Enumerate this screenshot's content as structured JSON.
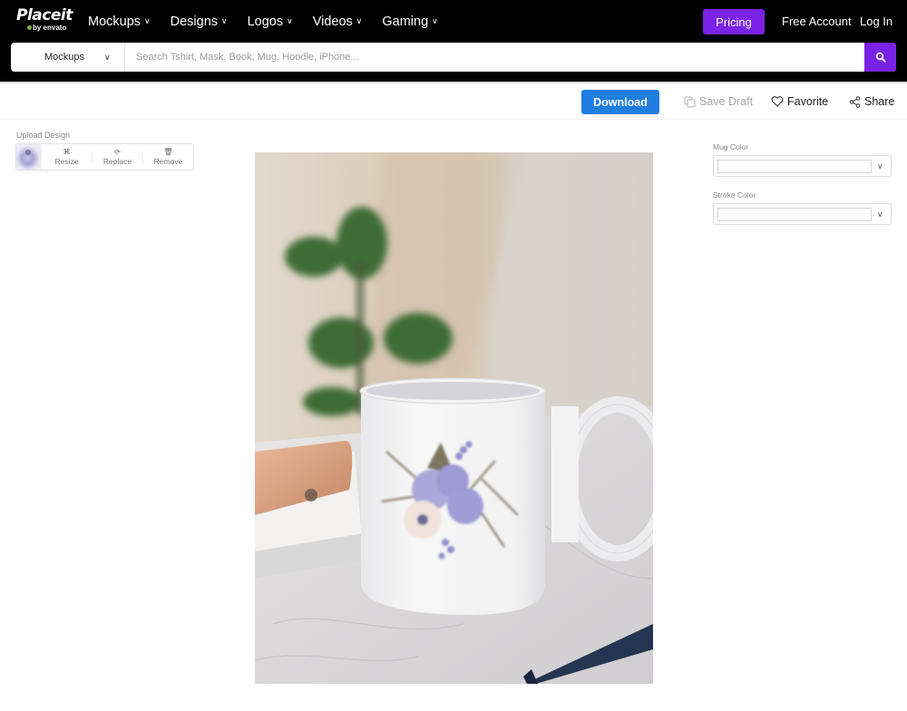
{
  "brand": {
    "name": "Placeit",
    "byline": "by envato",
    "accent_color": "#7a22e6",
    "download_color": "#1f7ee0"
  },
  "nav": {
    "items": [
      {
        "label": "Mockups"
      },
      {
        "label": "Designs"
      },
      {
        "label": "Logos"
      },
      {
        "label": "Videos"
      },
      {
        "label": "Gaming"
      }
    ],
    "pricing_label": "Pricing",
    "free_account_label": "Free Account",
    "login_label": "Log In"
  },
  "search": {
    "category": "Mockups",
    "placeholder": "Search Tshirt, Mask, Book, Mug, Hoodie, iPhone...",
    "value": ""
  },
  "toolbar": {
    "download_label": "Download",
    "save_draft_label": "Save Draft",
    "favorite_label": "Favorite",
    "share_label": "Share"
  },
  "upload": {
    "label": "Upload Design",
    "actions": [
      {
        "label": "Resize",
        "icon": "resize-icon"
      },
      {
        "label": "Replace",
        "icon": "replace-icon"
      },
      {
        "label": "Remove",
        "icon": "trash-icon"
      }
    ]
  },
  "options": {
    "mug_color": {
      "label": "Mug Color",
      "value": "#ffffff"
    },
    "stroke_color": {
      "label": "Stroke Color",
      "value": "#ffffff"
    }
  },
  "preview": {
    "description": "White ceramic mug with blue and cream floral design on marble table"
  }
}
